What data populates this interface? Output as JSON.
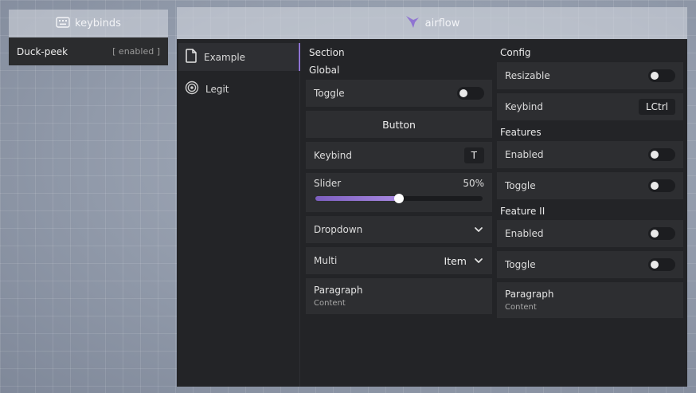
{
  "keybinds": {
    "title": "keybinds",
    "icon": "keyboard-icon",
    "items": [
      {
        "name": "Duck-peek",
        "state": "[ enabled ]"
      }
    ]
  },
  "window": {
    "title": "airflow",
    "logo": "airflow-logo-icon",
    "accent_color": "#8f74d2"
  },
  "sidebar": {
    "items": [
      {
        "label": "Example",
        "icon": "page-icon",
        "active": true
      },
      {
        "label": "Legit",
        "icon": "target-icon",
        "active": false
      }
    ]
  },
  "left": {
    "section_title": "Section",
    "group_title": "Global",
    "toggle": {
      "label": "Toggle",
      "value": false
    },
    "button": {
      "label": "Button"
    },
    "keybind": {
      "label": "Keybind",
      "value": "T"
    },
    "slider": {
      "label": "Slider",
      "value_text": "50%",
      "fraction": 0.5
    },
    "dropdown": {
      "label": "Dropdown"
    },
    "multi": {
      "label": "Multi",
      "value": "Item"
    },
    "paragraph": {
      "title": "Paragraph",
      "content": "Content"
    }
  },
  "right": {
    "config_title": "Config",
    "resizable": {
      "label": "Resizable",
      "value": false
    },
    "keybind": {
      "label": "Keybind",
      "value": "LCtrl"
    },
    "features_title": "Features",
    "features_enabled": {
      "label": "Enabled",
      "value": false
    },
    "features_toggle": {
      "label": "Toggle",
      "value": false
    },
    "feature2_title": "Feature II",
    "feature2_enabled": {
      "label": "Enabled",
      "value": false
    },
    "feature2_toggle": {
      "label": "Toggle",
      "value": false
    },
    "paragraph": {
      "title": "Paragraph",
      "content": "Content"
    }
  }
}
